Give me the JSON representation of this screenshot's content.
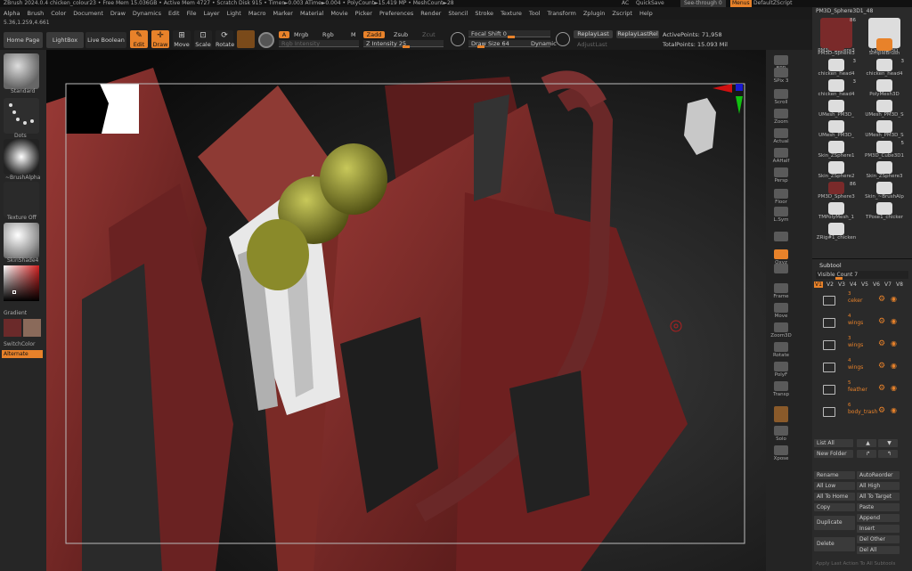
{
  "titlebar": {
    "text": "ZBrush 2024.0.4   chicken_colour23  • Free Mem 15.036GB • Active Mem 4727 • Scratch Disk 915 • Timer►0.003 ATime►0.004 • PolyCount►15.419 MP • MeshCount►28",
    "ac": "AC",
    "quicksave": "QuickSave",
    "see_through": "See-through  0",
    "menus": "Menus",
    "default_script": "DefaultZScript"
  },
  "menu": [
    "Alpha",
    "Brush",
    "Color",
    "Document",
    "Draw",
    "Dynamics",
    "Edit",
    "File",
    "Layer",
    "Light",
    "Macro",
    "Marker",
    "Material",
    "Movie",
    "Picker",
    "Preferences",
    "Render",
    "Stencil",
    "Stroke",
    "Texture",
    "Tool",
    "Transform",
    "Zplugin",
    "Zscript",
    "Help"
  ],
  "coords": "5.36,1.259,4.661",
  "top": {
    "home_page": "Home Page",
    "lightbox": "LightBox",
    "live_boolean": "Live Boolean",
    "edit": "Edit",
    "draw": "Draw",
    "move": "Move",
    "scale": "Scale",
    "rotate": "Rotate",
    "a": "A",
    "mrgb": "Mrgb",
    "rgb": "Rgb",
    "m": "M",
    "rgb_intensity": "Rgb Intensity",
    "zadd": "Zadd",
    "zsub": "Zsub",
    "zcut": "Zcut",
    "z_intensity": "Z Intensity 25",
    "focal_shift": "Focal Shift 0",
    "draw_size": "Draw Size 64",
    "dynamic": "Dynamic",
    "replay_last": "ReplayLast",
    "replay_last_rel": "ReplayLastRel",
    "adjust_last": "AdjustLast",
    "active_points": "ActivePoints: 71,958",
    "total_points": "TotalPoints: 15.093 Mil"
  },
  "left": {
    "standard": "Standard",
    "dots": "Dots",
    "brush_alpha": "~BrushAlpha",
    "texture_off": "Texture Off",
    "skin_shade": "SkinShade4",
    "gradient": "Gradient",
    "switch_color": "SwitchColor",
    "alternate": "Alternate",
    "colors": {
      "accent": "#e8822a",
      "main_color": "#6b2a2a",
      "secondary_color": "#8a6a5a"
    }
  },
  "right_shelf": [
    {
      "icon": "bpr-icon",
      "label": "BPR"
    },
    {
      "icon": "spix-icon",
      "label": "SPix 3"
    },
    {
      "icon": "scroll-icon",
      "label": "Scroll"
    },
    {
      "icon": "zoom-icon",
      "label": "Zoom"
    },
    {
      "icon": "actual-icon",
      "label": "Actual"
    },
    {
      "icon": "aahalf-icon",
      "label": "AAHalf"
    },
    {
      "icon": "persp-icon",
      "label": "Persp"
    },
    {
      "icon": "floor-icon",
      "label": "Floor"
    },
    {
      "icon": "lsym-icon",
      "label": "L.Sym"
    },
    {
      "icon": "lock-icon",
      "label": ""
    },
    {
      "icon": "xyz-icon",
      "label": "Qxyz"
    },
    {
      "icon": "rotate-icon",
      "label": ""
    },
    {
      "icon": "frame-icon",
      "label": "Frame"
    },
    {
      "icon": "move-icon",
      "label": "Move"
    },
    {
      "icon": "zoom3d-icon",
      "label": "Zoom3D"
    },
    {
      "icon": "rotate3d-icon",
      "label": "Rotate"
    },
    {
      "icon": "polyf-icon",
      "label": "PolyF"
    },
    {
      "icon": "transp-icon",
      "label": "Transp"
    },
    {
      "icon": "ghost-icon",
      "label": ""
    },
    {
      "icon": "solo-icon",
      "label": "Solo"
    },
    {
      "icon": "xpose-icon",
      "label": "Xpose"
    }
  ],
  "tool_header": "PM3D_Sphere3D1_48",
  "tools": [
    {
      "name": "PM3D_Sphere3",
      "count": "86"
    },
    {
      "name": "Cylinder3D",
      "count": ""
    },
    {
      "name": "PM3D_Sphere3",
      "count": ""
    },
    {
      "name": "SimpleBrush",
      "count": ""
    },
    {
      "name": "chicken_head4",
      "count": "3"
    },
    {
      "name": "chicken_head4",
      "count": "3"
    },
    {
      "name": "chicken_head4",
      "count": "3"
    },
    {
      "name": "PolyMesh3D",
      "count": ""
    },
    {
      "name": "UMesh_PM3D_",
      "count": ""
    },
    {
      "name": "UMesh_PM3D_S",
      "count": ""
    },
    {
      "name": "UMesh_PM3D_",
      "count": ""
    },
    {
      "name": "UMesh_PM3D_S",
      "count": ""
    },
    {
      "name": "Skin_ZSphere1",
      "count": ""
    },
    {
      "name": "PM3D_Cube3D1",
      "count": "5"
    },
    {
      "name": "Skin_ZSphere2",
      "count": ""
    },
    {
      "name": "Skin_ZSphere3",
      "count": ""
    },
    {
      "name": "PM3D_Sphere3",
      "count": "86"
    },
    {
      "name": "Skin_~BrushAlp",
      "count": ""
    },
    {
      "name": "TMPolyMesh_1",
      "count": ""
    },
    {
      "name": "TPose1_chicker",
      "count": ""
    },
    {
      "name": "ZRig#1_chicken",
      "count": ""
    }
  ],
  "subtool": {
    "title": "Subtool",
    "visible_count": "Visible Count 7",
    "tabs": [
      "V1",
      "V2",
      "V3",
      "V4",
      "V5",
      "V6",
      "V7",
      "V8"
    ],
    "items": [
      {
        "count": "3",
        "name": "ceker"
      },
      {
        "count": "4",
        "name": "wings"
      },
      {
        "count": "3",
        "name": "wings"
      },
      {
        "count": "4",
        "name": "wings"
      },
      {
        "count": "5",
        "name": "feather"
      },
      {
        "count": "6",
        "name": "body_trash"
      }
    ],
    "list_all": "List All",
    "new_folder": "New Folder",
    "rename": "Rename",
    "auto_reorder": "AutoReorder",
    "all_low": "All Low",
    "all_high": "All High",
    "all_to_home": "All To Home",
    "all_to_target": "All To Target",
    "copy": "Copy",
    "paste": "Paste",
    "duplicate": "Duplicate",
    "append": "Append",
    "insert": "Insert",
    "delete": "Delete",
    "del_other": "Del Other",
    "del_all": "Del All",
    "apply_last": "Apply Last Action To All Subtools"
  }
}
